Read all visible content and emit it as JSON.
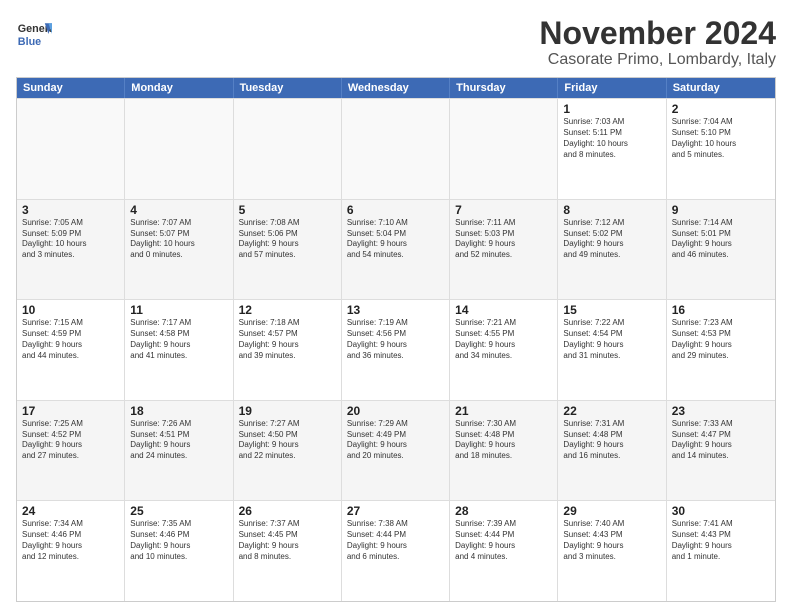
{
  "logo": {
    "line1": "General",
    "line2": "Blue"
  },
  "title": "November 2024",
  "subtitle": "Casorate Primo, Lombardy, Italy",
  "header_days": [
    "Sunday",
    "Monday",
    "Tuesday",
    "Wednesday",
    "Thursday",
    "Friday",
    "Saturday"
  ],
  "rows": [
    [
      {
        "day": "",
        "text": ""
      },
      {
        "day": "",
        "text": ""
      },
      {
        "day": "",
        "text": ""
      },
      {
        "day": "",
        "text": ""
      },
      {
        "day": "",
        "text": ""
      },
      {
        "day": "1",
        "text": "Sunrise: 7:03 AM\nSunset: 5:11 PM\nDaylight: 10 hours\nand 8 minutes."
      },
      {
        "day": "2",
        "text": "Sunrise: 7:04 AM\nSunset: 5:10 PM\nDaylight: 10 hours\nand 5 minutes."
      }
    ],
    [
      {
        "day": "3",
        "text": "Sunrise: 7:05 AM\nSunset: 5:09 PM\nDaylight: 10 hours\nand 3 minutes."
      },
      {
        "day": "4",
        "text": "Sunrise: 7:07 AM\nSunset: 5:07 PM\nDaylight: 10 hours\nand 0 minutes."
      },
      {
        "day": "5",
        "text": "Sunrise: 7:08 AM\nSunset: 5:06 PM\nDaylight: 9 hours\nand 57 minutes."
      },
      {
        "day": "6",
        "text": "Sunrise: 7:10 AM\nSunset: 5:04 PM\nDaylight: 9 hours\nand 54 minutes."
      },
      {
        "day": "7",
        "text": "Sunrise: 7:11 AM\nSunset: 5:03 PM\nDaylight: 9 hours\nand 52 minutes."
      },
      {
        "day": "8",
        "text": "Sunrise: 7:12 AM\nSunset: 5:02 PM\nDaylight: 9 hours\nand 49 minutes."
      },
      {
        "day": "9",
        "text": "Sunrise: 7:14 AM\nSunset: 5:01 PM\nDaylight: 9 hours\nand 46 minutes."
      }
    ],
    [
      {
        "day": "10",
        "text": "Sunrise: 7:15 AM\nSunset: 4:59 PM\nDaylight: 9 hours\nand 44 minutes."
      },
      {
        "day": "11",
        "text": "Sunrise: 7:17 AM\nSunset: 4:58 PM\nDaylight: 9 hours\nand 41 minutes."
      },
      {
        "day": "12",
        "text": "Sunrise: 7:18 AM\nSunset: 4:57 PM\nDaylight: 9 hours\nand 39 minutes."
      },
      {
        "day": "13",
        "text": "Sunrise: 7:19 AM\nSunset: 4:56 PM\nDaylight: 9 hours\nand 36 minutes."
      },
      {
        "day": "14",
        "text": "Sunrise: 7:21 AM\nSunset: 4:55 PM\nDaylight: 9 hours\nand 34 minutes."
      },
      {
        "day": "15",
        "text": "Sunrise: 7:22 AM\nSunset: 4:54 PM\nDaylight: 9 hours\nand 31 minutes."
      },
      {
        "day": "16",
        "text": "Sunrise: 7:23 AM\nSunset: 4:53 PM\nDaylight: 9 hours\nand 29 minutes."
      }
    ],
    [
      {
        "day": "17",
        "text": "Sunrise: 7:25 AM\nSunset: 4:52 PM\nDaylight: 9 hours\nand 27 minutes."
      },
      {
        "day": "18",
        "text": "Sunrise: 7:26 AM\nSunset: 4:51 PM\nDaylight: 9 hours\nand 24 minutes."
      },
      {
        "day": "19",
        "text": "Sunrise: 7:27 AM\nSunset: 4:50 PM\nDaylight: 9 hours\nand 22 minutes."
      },
      {
        "day": "20",
        "text": "Sunrise: 7:29 AM\nSunset: 4:49 PM\nDaylight: 9 hours\nand 20 minutes."
      },
      {
        "day": "21",
        "text": "Sunrise: 7:30 AM\nSunset: 4:48 PM\nDaylight: 9 hours\nand 18 minutes."
      },
      {
        "day": "22",
        "text": "Sunrise: 7:31 AM\nSunset: 4:48 PM\nDaylight: 9 hours\nand 16 minutes."
      },
      {
        "day": "23",
        "text": "Sunrise: 7:33 AM\nSunset: 4:47 PM\nDaylight: 9 hours\nand 14 minutes."
      }
    ],
    [
      {
        "day": "24",
        "text": "Sunrise: 7:34 AM\nSunset: 4:46 PM\nDaylight: 9 hours\nand 12 minutes."
      },
      {
        "day": "25",
        "text": "Sunrise: 7:35 AM\nSunset: 4:46 PM\nDaylight: 9 hours\nand 10 minutes."
      },
      {
        "day": "26",
        "text": "Sunrise: 7:37 AM\nSunset: 4:45 PM\nDaylight: 9 hours\nand 8 minutes."
      },
      {
        "day": "27",
        "text": "Sunrise: 7:38 AM\nSunset: 4:44 PM\nDaylight: 9 hours\nand 6 minutes."
      },
      {
        "day": "28",
        "text": "Sunrise: 7:39 AM\nSunset: 4:44 PM\nDaylight: 9 hours\nand 4 minutes."
      },
      {
        "day": "29",
        "text": "Sunrise: 7:40 AM\nSunset: 4:43 PM\nDaylight: 9 hours\nand 3 minutes."
      },
      {
        "day": "30",
        "text": "Sunrise: 7:41 AM\nSunset: 4:43 PM\nDaylight: 9 hours\nand 1 minute."
      }
    ]
  ]
}
